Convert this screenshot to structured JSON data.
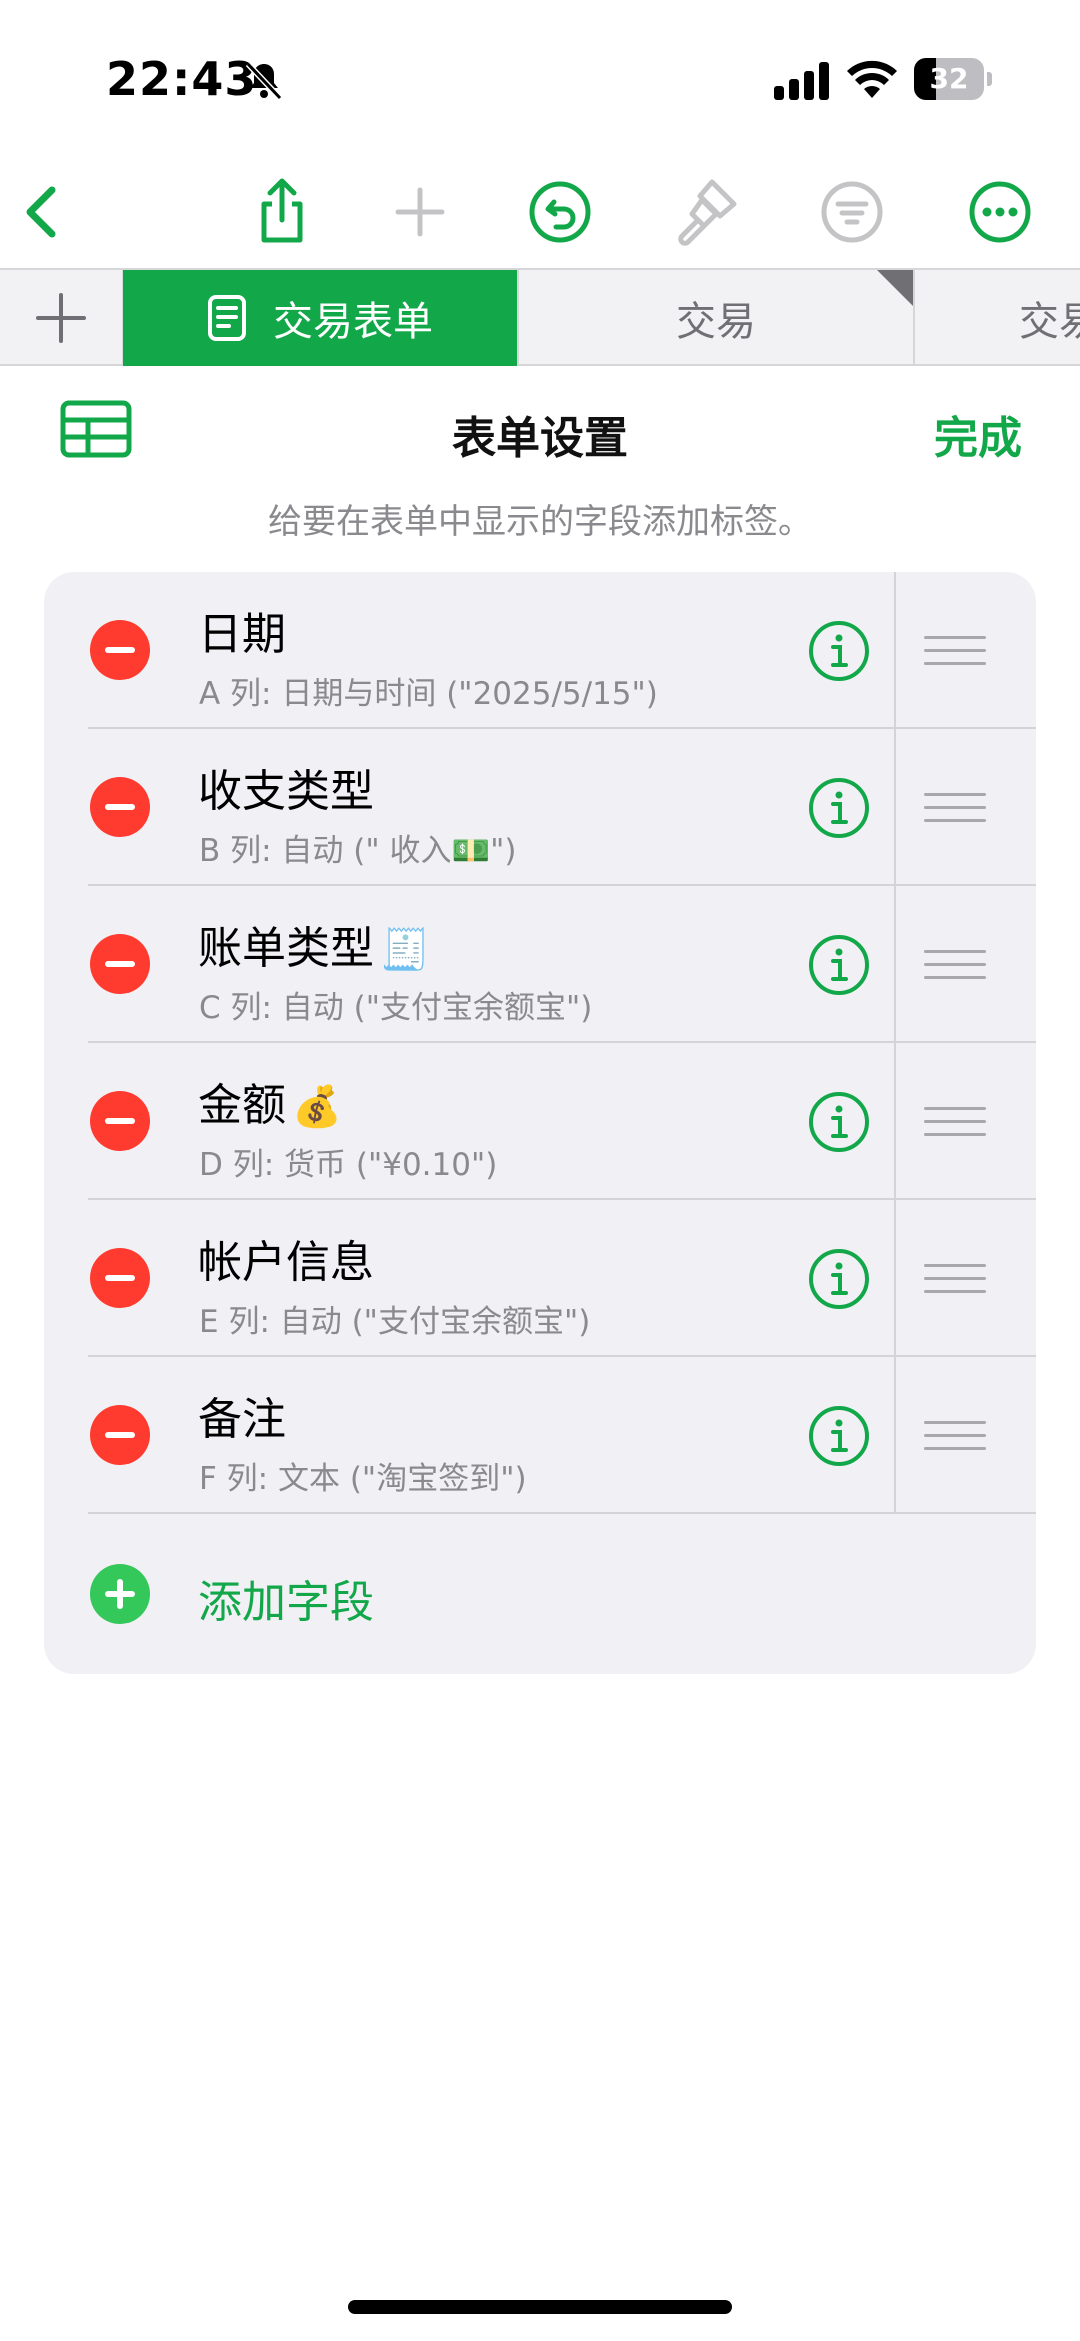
{
  "status_bar": {
    "time": "22:43",
    "battery": "32",
    "battery_level": 0.32,
    "icons": [
      "bell-slash-icon",
      "signal-icon",
      "wifi-icon",
      "battery-icon"
    ]
  },
  "toolbar": {
    "items": [
      "back-chevron-icon",
      "share-icon",
      "add-icon",
      "undo-icon",
      "format-brush-icon",
      "filter-icon",
      "more-icon"
    ]
  },
  "tabs": {
    "items": [
      {
        "label": "交易表单",
        "active": true
      },
      {
        "label": "交易",
        "active": false
      },
      {
        "label": "交易",
        "active": false
      }
    ]
  },
  "sheet": {
    "title": "表单设置",
    "done": "完成",
    "hint": "给要在表单中显示的字段添加标签。"
  },
  "fields": [
    {
      "name": "日期",
      "emoji": "",
      "desc": "A 列: 日期与时间 (\"2025/5/15\")"
    },
    {
      "name": "收支类型",
      "emoji": "",
      "desc": "B 列: 自动 (\" 收入💵\")"
    },
    {
      "name": "账单类型",
      "emoji": "🧾",
      "desc": "C 列: 自动 (\"支付宝余额宝\")"
    },
    {
      "name": "金额",
      "emoji": "💰",
      "desc": "D 列: 货币 (\"¥0.10\")"
    },
    {
      "name": "帐户信息",
      "emoji": "",
      "desc": "E 列: 自动 (\"支付宝余额宝\")"
    },
    {
      "name": "备注",
      "emoji": "",
      "desc": "F 列: 文本 (\"淘宝签到\")"
    }
  ],
  "add_field": "添加字段",
  "colors": {
    "accent": "#12a84a",
    "delete": "#ff3b30",
    "add": "#34c759"
  }
}
